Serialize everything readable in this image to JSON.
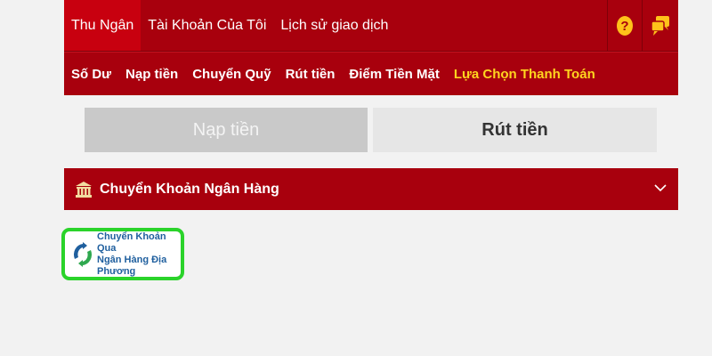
{
  "header": {
    "tabs": [
      {
        "label": "Thu Ngân",
        "active": true
      },
      {
        "label": "Tài Khoản Của Tôi",
        "active": false
      },
      {
        "label": "Lịch sử giao dịch",
        "active": false
      }
    ],
    "icons": [
      "help-icon",
      "chat-icon"
    ]
  },
  "subnav": {
    "items": [
      {
        "label": "Số Dư",
        "active": false
      },
      {
        "label": "Nạp tiền",
        "active": false
      },
      {
        "label": "Chuyển Quỹ",
        "active": false
      },
      {
        "label": "Rút tiền",
        "active": false
      },
      {
        "label": "Điểm Tiền Mặt",
        "active": false
      },
      {
        "label": "Lựa Chọn Thanh Toán",
        "active": true
      }
    ]
  },
  "switcher": {
    "deposit_label": "Nạp tiền",
    "withdraw_label": "Rút tiền",
    "selected": "withdraw"
  },
  "bank_section": {
    "title": "Chuyển Khoản Ngân Hàng",
    "icon": "bank-icon",
    "expanded": true
  },
  "payment_option": {
    "line1": "Chuyển Khoản Qua",
    "line2": "Ngân Hàng Địa Phương",
    "selected": true
  },
  "colors": {
    "primary_red": "#a8000d",
    "active_tab": "#c8000f",
    "highlight_yellow": "#ffd51f",
    "selected_border": "#2ad32a"
  }
}
